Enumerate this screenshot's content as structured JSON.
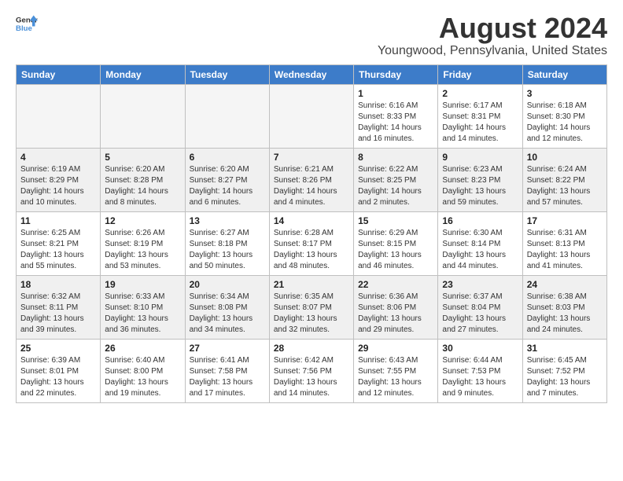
{
  "header": {
    "logo_general": "General",
    "logo_blue": "Blue",
    "month_year": "August 2024",
    "location": "Youngwood, Pennsylvania, United States"
  },
  "weekdays": [
    "Sunday",
    "Monday",
    "Tuesday",
    "Wednesday",
    "Thursday",
    "Friday",
    "Saturday"
  ],
  "weeks": [
    [
      {
        "day": "",
        "empty": true
      },
      {
        "day": "",
        "empty": true
      },
      {
        "day": "",
        "empty": true
      },
      {
        "day": "",
        "empty": true
      },
      {
        "day": "1",
        "sunrise": "6:16 AM",
        "sunset": "8:33 PM",
        "daylight": "14 hours and 16 minutes."
      },
      {
        "day": "2",
        "sunrise": "6:17 AM",
        "sunset": "8:31 PM",
        "daylight": "14 hours and 14 minutes."
      },
      {
        "day": "3",
        "sunrise": "6:18 AM",
        "sunset": "8:30 PM",
        "daylight": "14 hours and 12 minutes."
      }
    ],
    [
      {
        "day": "4",
        "sunrise": "6:19 AM",
        "sunset": "8:29 PM",
        "daylight": "14 hours and 10 minutes."
      },
      {
        "day": "5",
        "sunrise": "6:20 AM",
        "sunset": "8:28 PM",
        "daylight": "14 hours and 8 minutes."
      },
      {
        "day": "6",
        "sunrise": "6:20 AM",
        "sunset": "8:27 PM",
        "daylight": "14 hours and 6 minutes."
      },
      {
        "day": "7",
        "sunrise": "6:21 AM",
        "sunset": "8:26 PM",
        "daylight": "14 hours and 4 minutes."
      },
      {
        "day": "8",
        "sunrise": "6:22 AM",
        "sunset": "8:25 PM",
        "daylight": "14 hours and 2 minutes."
      },
      {
        "day": "9",
        "sunrise": "6:23 AM",
        "sunset": "8:23 PM",
        "daylight": "13 hours and 59 minutes."
      },
      {
        "day": "10",
        "sunrise": "6:24 AM",
        "sunset": "8:22 PM",
        "daylight": "13 hours and 57 minutes."
      }
    ],
    [
      {
        "day": "11",
        "sunrise": "6:25 AM",
        "sunset": "8:21 PM",
        "daylight": "13 hours and 55 minutes."
      },
      {
        "day": "12",
        "sunrise": "6:26 AM",
        "sunset": "8:19 PM",
        "daylight": "13 hours and 53 minutes."
      },
      {
        "day": "13",
        "sunrise": "6:27 AM",
        "sunset": "8:18 PM",
        "daylight": "13 hours and 50 minutes."
      },
      {
        "day": "14",
        "sunrise": "6:28 AM",
        "sunset": "8:17 PM",
        "daylight": "13 hours and 48 minutes."
      },
      {
        "day": "15",
        "sunrise": "6:29 AM",
        "sunset": "8:15 PM",
        "daylight": "13 hours and 46 minutes."
      },
      {
        "day": "16",
        "sunrise": "6:30 AM",
        "sunset": "8:14 PM",
        "daylight": "13 hours and 44 minutes."
      },
      {
        "day": "17",
        "sunrise": "6:31 AM",
        "sunset": "8:13 PM",
        "daylight": "13 hours and 41 minutes."
      }
    ],
    [
      {
        "day": "18",
        "sunrise": "6:32 AM",
        "sunset": "8:11 PM",
        "daylight": "13 hours and 39 minutes."
      },
      {
        "day": "19",
        "sunrise": "6:33 AM",
        "sunset": "8:10 PM",
        "daylight": "13 hours and 36 minutes."
      },
      {
        "day": "20",
        "sunrise": "6:34 AM",
        "sunset": "8:08 PM",
        "daylight": "13 hours and 34 minutes."
      },
      {
        "day": "21",
        "sunrise": "6:35 AM",
        "sunset": "8:07 PM",
        "daylight": "13 hours and 32 minutes."
      },
      {
        "day": "22",
        "sunrise": "6:36 AM",
        "sunset": "8:06 PM",
        "daylight": "13 hours and 29 minutes."
      },
      {
        "day": "23",
        "sunrise": "6:37 AM",
        "sunset": "8:04 PM",
        "daylight": "13 hours and 27 minutes."
      },
      {
        "day": "24",
        "sunrise": "6:38 AM",
        "sunset": "8:03 PM",
        "daylight": "13 hours and 24 minutes."
      }
    ],
    [
      {
        "day": "25",
        "sunrise": "6:39 AM",
        "sunset": "8:01 PM",
        "daylight": "13 hours and 22 minutes."
      },
      {
        "day": "26",
        "sunrise": "6:40 AM",
        "sunset": "8:00 PM",
        "daylight": "13 hours and 19 minutes."
      },
      {
        "day": "27",
        "sunrise": "6:41 AM",
        "sunset": "7:58 PM",
        "daylight": "13 hours and 17 minutes."
      },
      {
        "day": "28",
        "sunrise": "6:42 AM",
        "sunset": "7:56 PM",
        "daylight": "13 hours and 14 minutes."
      },
      {
        "day": "29",
        "sunrise": "6:43 AM",
        "sunset": "7:55 PM",
        "daylight": "13 hours and 12 minutes."
      },
      {
        "day": "30",
        "sunrise": "6:44 AM",
        "sunset": "7:53 PM",
        "daylight": "13 hours and 9 minutes."
      },
      {
        "day": "31",
        "sunrise": "6:45 AM",
        "sunset": "7:52 PM",
        "daylight": "13 hours and 7 minutes."
      }
    ]
  ]
}
